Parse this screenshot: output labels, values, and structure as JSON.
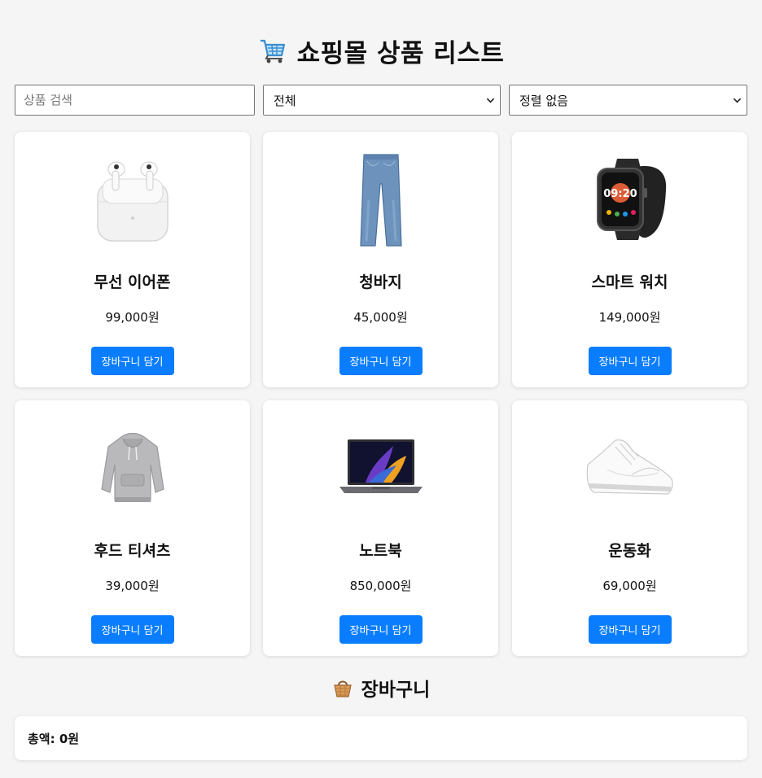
{
  "header": {
    "title": "쇼핑몰 상품 리스트",
    "icon": "shopping-cart-icon"
  },
  "filters": {
    "search_placeholder": "상품 검색",
    "search_value": "",
    "category_selected": "전체",
    "sort_selected": "정렬 없음"
  },
  "products": [
    {
      "name": "무선 이어폰",
      "price": "99,000원",
      "button": "장바구니 담기",
      "image": "earbuds-image"
    },
    {
      "name": "청바지",
      "price": "45,000원",
      "button": "장바구니 담기",
      "image": "jeans-image"
    },
    {
      "name": "스마트 워치",
      "price": "149,000원",
      "button": "장바구니 담기",
      "image": "smartwatch-image"
    },
    {
      "name": "후드 티셔츠",
      "price": "39,000원",
      "button": "장바구니 담기",
      "image": "hoodie-image"
    },
    {
      "name": "노트북",
      "price": "850,000원",
      "button": "장바구니 담기",
      "image": "laptop-image"
    },
    {
      "name": "운동화",
      "price": "69,000원",
      "button": "장바구니 담기",
      "image": "sneakers-image"
    }
  ],
  "cart": {
    "title": "장바구니",
    "icon": "basket-icon",
    "total": "총액: 0원"
  },
  "colors": {
    "accent": "#0a7dff",
    "background": "#f5f5f5",
    "card": "#ffffff"
  }
}
